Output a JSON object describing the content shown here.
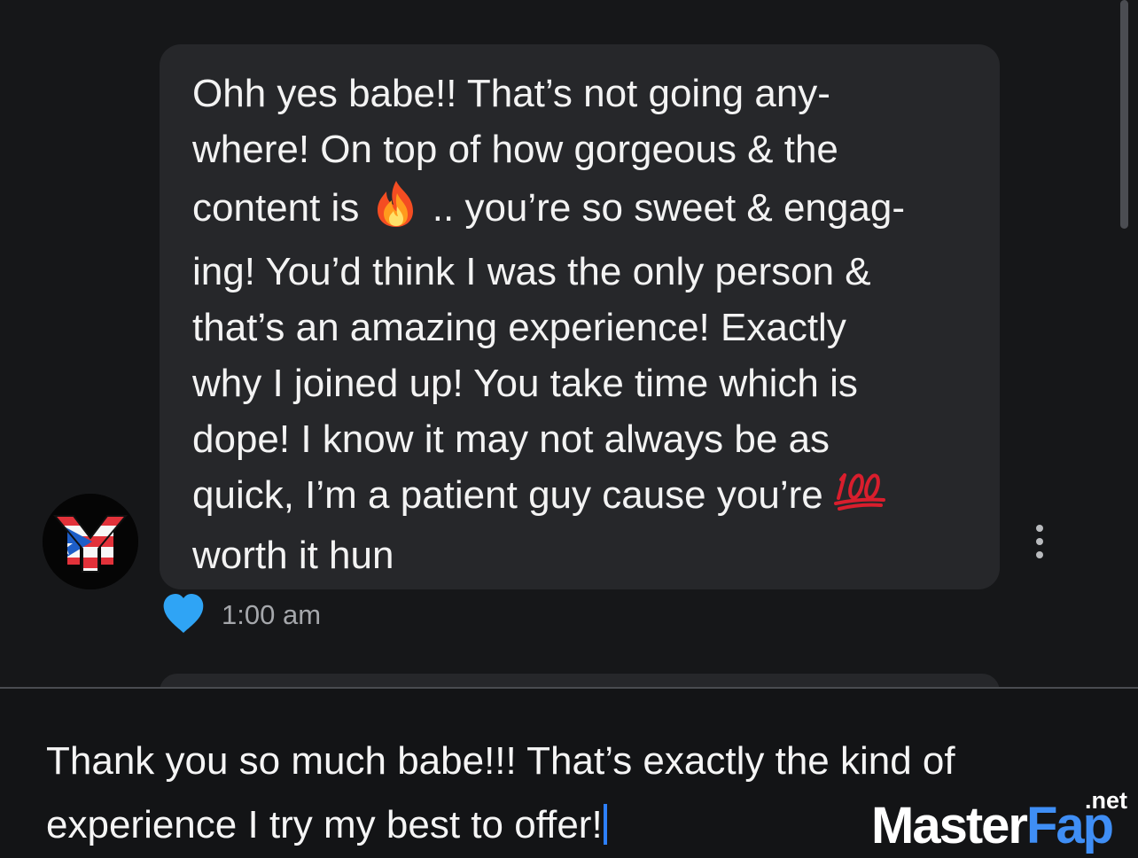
{
  "incoming_message": {
    "lines": [
      {
        "text": "Ohh yes babe!! That’s not going any-"
      },
      {
        "text": "where! On top of how gorgeous & the"
      },
      {
        "before": "content is ",
        "emoji": "fire",
        "after": " .. you’re so sweet & engag-"
      },
      {
        "text": "ing! You’d think I was the only person &"
      },
      {
        "text": "that’s an amazing experience! Exactly"
      },
      {
        "text": "why I joined up! You take time which is"
      },
      {
        "text": "dope! I know it may not always be as"
      },
      {
        "before": "quick, I’m a patient guy cause you’re ",
        "emoji": "hundred-points"
      },
      {
        "text": "worth it hun"
      }
    ],
    "timestamp": "1:00 am",
    "liked": true,
    "like_color": "#2fa4f5"
  },
  "avatar": {
    "icon": "ny-puerto-rico-flag-logo"
  },
  "message_actions": {
    "icon": "more-vertical-icon"
  },
  "composer": {
    "lines": [
      "Thank you so much babe!!! That’s exactly the kind of",
      "experience I try my best to offer!"
    ],
    "caret_color": "#2d80ff"
  },
  "watermark": {
    "main_white": "Master",
    "main_blue": "Fap",
    "suffix": ".net"
  },
  "colors": {
    "background": "#161719",
    "bubble": "#26272a",
    "text": "#f3f3f3",
    "muted_text": "#a5a7ab",
    "accent_blue": "#2fa4f5"
  }
}
